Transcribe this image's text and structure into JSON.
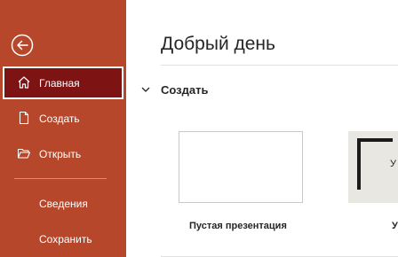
{
  "sidebar": {
    "back_icon": "back-arrow-icon",
    "items": [
      {
        "label": "Главная",
        "icon": "home-icon",
        "selected": true
      },
      {
        "label": "Создать",
        "icon": "new-file-icon"
      },
      {
        "label": "Открыть",
        "icon": "open-folder-icon"
      },
      {
        "label": "Сведения"
      },
      {
        "label": "Сохранить"
      }
    ]
  },
  "main": {
    "title": "Добрый день",
    "section": {
      "label": "Создать",
      "icon": "chevron-down-icon"
    },
    "templates": [
      {
        "label": "Пустая презентация"
      },
      {
        "label": "У",
        "thumb_text": "У"
      }
    ]
  },
  "colors": {
    "sidebar_bg": "#b7472a",
    "selected_bg": "#7d1313",
    "text": "#262626",
    "welcome_thumb_bg": "#e9e7e1"
  }
}
